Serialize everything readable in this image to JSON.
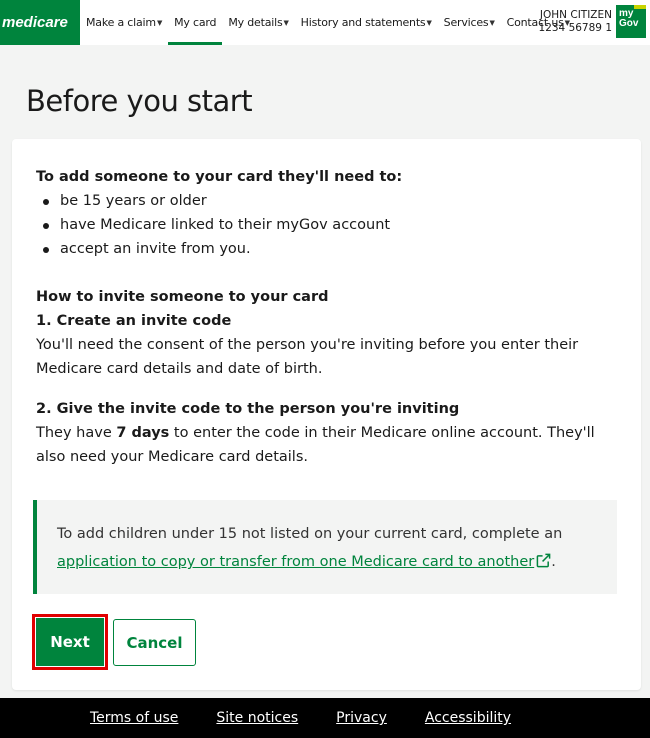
{
  "header": {
    "logo_text": "medicare",
    "nav": [
      {
        "label": "Make a claim",
        "caret": true
      },
      {
        "label": "My card",
        "caret": false
      },
      {
        "label": "My details",
        "caret": true
      },
      {
        "label": "History and statements",
        "caret": true
      },
      {
        "label": "Services",
        "caret": true
      },
      {
        "label": "Contact us",
        "caret": true
      }
    ],
    "user_name": "JOHN CITIZEN",
    "user_card": "1234 56789 1",
    "mygov_line1": "my",
    "mygov_line2": "Gov"
  },
  "page": {
    "title": "Before you start"
  },
  "requirements": {
    "heading": "To add someone to your card they'll need to:",
    "items": [
      "be 15 years or older",
      "have Medicare linked to their myGov account",
      "accept an invite from you."
    ]
  },
  "how_to": {
    "heading": "How to invite someone to your card",
    "step1_heading": "1. Create an invite code",
    "step1_text": "You'll need the consent of the person you're inviting before you enter their Medicare card details and date of birth.",
    "step2_heading": "2. Give the invite code to the person you're inviting",
    "step2_text_before": "They have ",
    "step2_text_bold": "7 days",
    "step2_text_after": " to enter the code in their Medicare online account. They'll also need your Medicare card details."
  },
  "notice": {
    "text_before": "To add children under 15 not listed on your current card, complete an ",
    "link_text": "application to copy or transfer from one Medicare card to another",
    "text_after": "."
  },
  "buttons": {
    "next": "Next",
    "cancel": "Cancel"
  },
  "footer": {
    "links": [
      "Terms of use",
      "Site notices",
      "Privacy",
      "Accessibility"
    ]
  },
  "colors": {
    "brand_green": "#00843d",
    "highlight_red": "#e00000",
    "footer_bg": "#000000"
  }
}
